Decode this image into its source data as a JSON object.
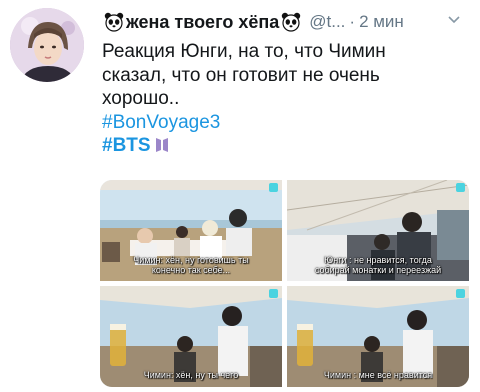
{
  "tweet": {
    "display_name": "жена твоего хёпа",
    "handle": "@t...",
    "separator": "·",
    "time": "2 мин",
    "text_lines": [
      "Реакция Юнги, на то, что Чимин",
      "сказал, что он готовит не очень",
      "хорошо.."
    ],
    "hashtags": [
      "#BonVoyage3",
      "#BTS"
    ]
  },
  "media": [
    {
      "subtitle_lines": [
        "Чимин: хён, ну готовишь ты",
        "конечно так себе..."
      ]
    },
    {
      "subtitle_lines": [
        "Юнги : не нравится, тогда",
        "собирай монатки и переезжай"
      ]
    },
    {
      "subtitle_lines": [
        "Чимин: хён, ну ты чего"
      ]
    },
    {
      "subtitle_lines": [
        "Чимин : мне всё нравится"
      ]
    }
  ],
  "icons": {
    "emoji": "panda-face-icon",
    "bts": "bts-logo-icon",
    "menu": "chevron-down-icon"
  },
  "colors": {
    "link": "#1b95e0",
    "text": "#14171a",
    "muted": "#657786"
  }
}
